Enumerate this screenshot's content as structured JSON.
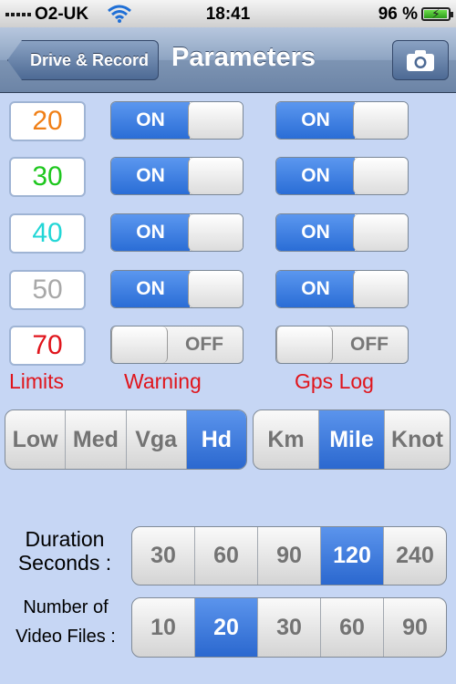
{
  "status_bar": {
    "carrier": "O2-UK",
    "time": "18:41",
    "battery_percent": "96 %",
    "battery_level": 0.96
  },
  "nav": {
    "back_label": "Drive & Record",
    "title": "Parameters"
  },
  "limits": [
    {
      "value": "20",
      "color": "#f07f16"
    },
    {
      "value": "30",
      "color": "#1ec71e"
    },
    {
      "value": "40",
      "color": "#22d6d6"
    },
    {
      "value": "50",
      "color": "#a8a8a8"
    },
    {
      "value": "70",
      "color": "#e0151c"
    }
  ],
  "warning_toggles": [
    {
      "state": "on",
      "label": "ON"
    },
    {
      "state": "on",
      "label": "ON"
    },
    {
      "state": "on",
      "label": "ON"
    },
    {
      "state": "on",
      "label": "ON"
    },
    {
      "state": "off",
      "label": "OFF"
    }
  ],
  "gps_toggles": [
    {
      "state": "on",
      "label": "ON"
    },
    {
      "state": "on",
      "label": "ON"
    },
    {
      "state": "on",
      "label": "ON"
    },
    {
      "state": "on",
      "label": "ON"
    },
    {
      "state": "off",
      "label": "OFF"
    }
  ],
  "labels": {
    "limits": "Limits",
    "warning": "Warning",
    "gps_log": "Gps Log"
  },
  "quality": {
    "options": [
      "Low",
      "Med",
      "Vga",
      "Hd"
    ],
    "selected": 3
  },
  "units": {
    "options": [
      "Km",
      "Mile",
      "Knot"
    ],
    "selected": 1
  },
  "duration": {
    "label_line1": "Duration",
    "label_line2": "Seconds :",
    "options": [
      "30",
      "60",
      "90",
      "120",
      "240"
    ],
    "selected": 3
  },
  "video_files": {
    "label_line1": "Number of",
    "label_line2": "Video Files :",
    "options": [
      "10",
      "20",
      "30",
      "60",
      "90"
    ],
    "selected": 1
  },
  "colors": {
    "accent_blue": "#2b68cf",
    "label_red": "#e0151c"
  }
}
